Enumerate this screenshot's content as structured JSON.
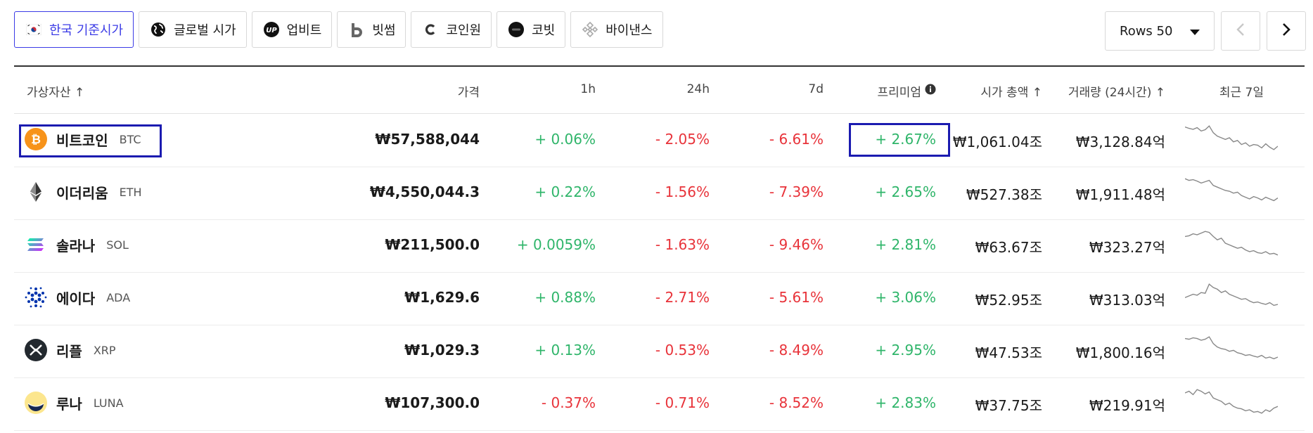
{
  "tabs": [
    {
      "label": "한국 기준시가",
      "icon": "korea-flag-icon",
      "active": true
    },
    {
      "label": "글로벌 시가",
      "icon": "globe-icon",
      "active": false
    },
    {
      "label": "업비트",
      "icon": "upbit-logo-icon",
      "active": false
    },
    {
      "label": "빗썸",
      "icon": "bithumb-logo-icon",
      "active": false
    },
    {
      "label": "코인원",
      "icon": "coinone-logo-icon",
      "active": false
    },
    {
      "label": "코빗",
      "icon": "korbit-logo-icon",
      "active": false
    },
    {
      "label": "바이낸스",
      "icon": "binance-logo-icon",
      "active": false
    }
  ],
  "rows_select": {
    "label": "Rows 50"
  },
  "header": {
    "asset": "가상자산 ↑",
    "price": "가격",
    "h1": "1h",
    "h24": "24h",
    "d7": "7d",
    "premium": "프리미엄",
    "mcap": "시가 총액 ↑",
    "volume": "거래량 (24시간) ↑",
    "recent7": "최근 7일"
  },
  "rows": [
    {
      "name": "비트코인",
      "symbol": "BTC",
      "icon": "bitcoin-icon",
      "color": "#f7931a",
      "price": "₩57,588,044",
      "h1": "+ 0.06%",
      "h24": "- 2.05%",
      "d7": "- 6.61%",
      "premium": "+ 2.67%",
      "mcap": "₩1,061.04조",
      "volume": "₩3,128.84억",
      "spark": [
        0.82,
        0.78,
        0.75,
        0.8,
        0.7,
        0.74,
        0.85,
        0.65,
        0.55,
        0.5,
        0.45,
        0.5,
        0.38,
        0.42,
        0.3,
        0.35,
        0.25,
        0.3,
        0.28,
        0.2,
        0.32,
        0.22,
        0.15,
        0.25
      ]
    },
    {
      "name": "이더리움",
      "symbol": "ETH",
      "icon": "ethereum-icon",
      "color": "#3c3c3d",
      "price": "₩4,550,044.3",
      "h1": "+ 0.22%",
      "h24": "- 1.56%",
      "d7": "- 7.39%",
      "premium": "+ 2.65%",
      "mcap": "₩527.38조",
      "volume": "₩1,911.48억",
      "spark": [
        0.85,
        0.8,
        0.82,
        0.78,
        0.72,
        0.76,
        0.8,
        0.65,
        0.6,
        0.55,
        0.5,
        0.48,
        0.42,
        0.45,
        0.35,
        0.3,
        0.25,
        0.32,
        0.28,
        0.22,
        0.3,
        0.25,
        0.2,
        0.28
      ]
    },
    {
      "name": "솔라나",
      "symbol": "SOL",
      "icon": "solana-icon",
      "color": "#8d5ce0",
      "price": "₩211,500.0",
      "h1": "+ 0.0059%",
      "h24": "- 1.63%",
      "d7": "- 9.46%",
      "premium": "+ 2.81%",
      "mcap": "₩63.67조",
      "volume": "₩323.27억",
      "spark": [
        0.7,
        0.72,
        0.78,
        0.75,
        0.8,
        0.85,
        0.82,
        0.7,
        0.6,
        0.65,
        0.5,
        0.45,
        0.4,
        0.35,
        0.38,
        0.3,
        0.25,
        0.28,
        0.22,
        0.2,
        0.25,
        0.18,
        0.2,
        0.15
      ]
    },
    {
      "name": "에이다",
      "symbol": "ADA",
      "icon": "cardano-icon",
      "color": "#0033ad",
      "price": "₩1,629.6",
      "h1": "+ 0.88%",
      "h24": "- 2.71%",
      "d7": "- 5.61%",
      "premium": "+ 3.06%",
      "mcap": "₩52.95조",
      "volume": "₩313.03억",
      "spark": [
        0.45,
        0.5,
        0.55,
        0.52,
        0.6,
        0.58,
        0.85,
        0.75,
        0.7,
        0.6,
        0.65,
        0.55,
        0.5,
        0.45,
        0.4,
        0.42,
        0.35,
        0.3,
        0.32,
        0.28,
        0.25,
        0.3,
        0.22,
        0.25
      ]
    },
    {
      "name": "리플",
      "symbol": "XRP",
      "icon": "xrp-icon",
      "color": "#23292f",
      "price": "₩1,029.3",
      "h1": "+ 0.13%",
      "h24": "- 0.53%",
      "d7": "- 8.49%",
      "premium": "+ 2.95%",
      "mcap": "₩47.53조",
      "volume": "₩1,800.16억",
      "spark": [
        0.8,
        0.78,
        0.82,
        0.8,
        0.75,
        0.78,
        0.85,
        0.65,
        0.55,
        0.5,
        0.48,
        0.42,
        0.45,
        0.38,
        0.35,
        0.3,
        0.32,
        0.28,
        0.25,
        0.3,
        0.22,
        0.25,
        0.2,
        0.25
      ]
    },
    {
      "name": "루나",
      "symbol": "LUNA",
      "icon": "terra-luna-icon",
      "color": "#f9d85e",
      "price": "₩107,300.0",
      "h1": "- 0.37%",
      "h24": "- 0.71%",
      "d7": "- 8.52%",
      "premium": "+ 2.83%",
      "mcap": "₩37.75조",
      "volume": "₩219.91억",
      "spark": [
        0.75,
        0.8,
        0.7,
        0.85,
        0.8,
        0.72,
        0.78,
        0.6,
        0.55,
        0.5,
        0.4,
        0.45,
        0.35,
        0.3,
        0.28,
        0.22,
        0.25,
        0.18,
        0.2,
        0.15,
        0.25,
        0.2,
        0.3,
        0.35
      ]
    }
  ],
  "colors": {
    "accent": "#3b3be6",
    "up": "#2fb56a",
    "down": "#e8333a",
    "highlight": "#1b1bb0"
  }
}
